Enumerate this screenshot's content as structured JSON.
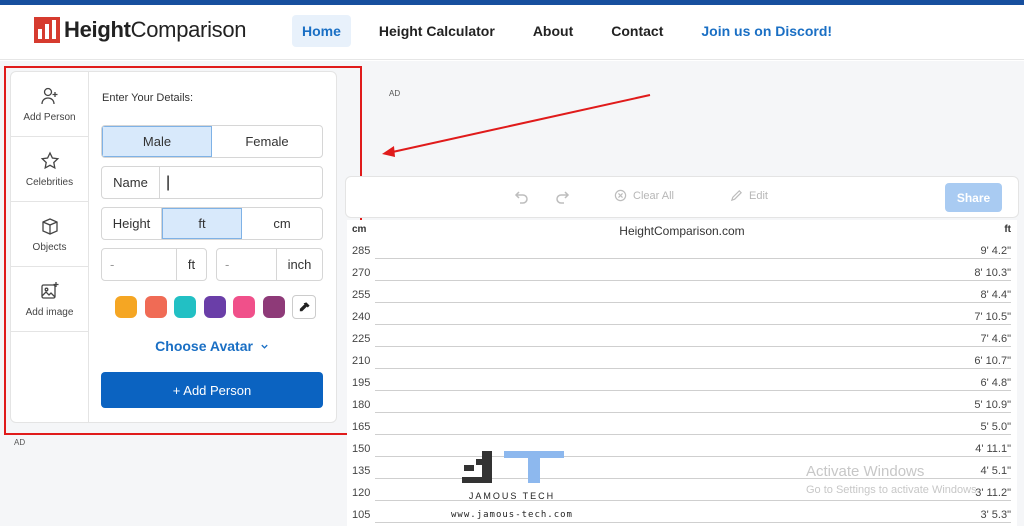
{
  "brand": {
    "name_bold": "Height",
    "name_rest": "Comparison"
  },
  "nav": [
    "Home",
    "Height Calculator",
    "About",
    "Contact",
    "Join us on Discord!"
  ],
  "sidebar": [
    {
      "label": "Add Person",
      "icon": "add-person-icon"
    },
    {
      "label": "Celebrities",
      "icon": "star-icon"
    },
    {
      "label": "Objects",
      "icon": "cube-icon"
    },
    {
      "label": "Add image",
      "icon": "image-add-icon"
    }
  ],
  "form": {
    "title": "Enter Your Details:",
    "gender_options": [
      "Male",
      "Female"
    ],
    "gender_selected": "Male",
    "name_label": "Name",
    "name_value": "|",
    "height_label": "Height",
    "height_units": [
      "ft",
      "cm"
    ],
    "height_unit_selected": "ft",
    "feet_value": "-",
    "feet_unit": "ft",
    "inches_value": "-",
    "inches_unit": "inch",
    "colors": [
      "#f5a623",
      "#f06b55",
      "#22c0c4",
      "#6a3ea8",
      "#f0508a",
      "#8e3a78"
    ],
    "choose_avatar": "Choose Avatar",
    "add_button": "+ Add Person"
  },
  "ad_label": "AD",
  "toolbar": {
    "clear_all": "Clear All",
    "edit": "Edit",
    "share": "Share"
  },
  "chart": {
    "left_unit": "cm",
    "right_unit": "ft",
    "site": "HeightComparison.com",
    "rows": [
      {
        "cm": "285",
        "ft": "9' 4.2\""
      },
      {
        "cm": "270",
        "ft": "8' 10.3\""
      },
      {
        "cm": "255",
        "ft": "8' 4.4\""
      },
      {
        "cm": "240",
        "ft": "7' 10.5\""
      },
      {
        "cm": "225",
        "ft": "7' 4.6\""
      },
      {
        "cm": "210",
        "ft": "6' 10.7\""
      },
      {
        "cm": "195",
        "ft": "6' 4.8\""
      },
      {
        "cm": "180",
        "ft": "5' 10.9\""
      },
      {
        "cm": "165",
        "ft": "5' 5.0\""
      },
      {
        "cm": "150",
        "ft": "4' 11.1\""
      },
      {
        "cm": "135",
        "ft": "4' 5.1\""
      },
      {
        "cm": "120",
        "ft": "3' 11.2\""
      },
      {
        "cm": "105",
        "ft": "3' 5.3\""
      }
    ]
  },
  "watermark": {
    "name": "JAMOUS TECH",
    "url": "www.jamous-tech.com"
  },
  "activate": {
    "title": "Activate Windows",
    "subtitle": "Go to Settings to activate Windows."
  }
}
